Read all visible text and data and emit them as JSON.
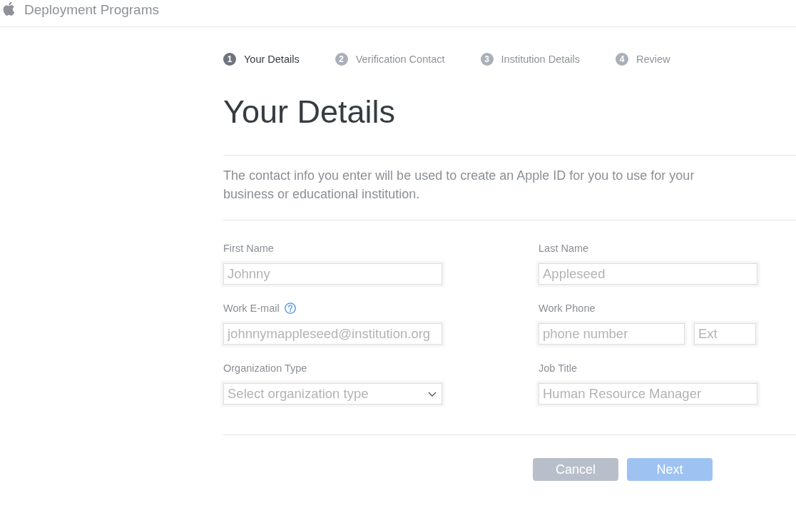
{
  "header": {
    "title": "Deployment Programs"
  },
  "steps": [
    {
      "number": "1",
      "label": "Your Details",
      "selected": true
    },
    {
      "number": "2",
      "label": "Verification Contact",
      "selected": false
    },
    {
      "number": "3",
      "label": "Institution Details",
      "selected": false
    },
    {
      "number": "4",
      "label": "Review",
      "selected": false
    }
  ],
  "page": {
    "title": "Your Details",
    "description": "The contact info you enter will be used to create an Apple ID for you to use for your business or educational institution."
  },
  "form": {
    "fields": [
      {
        "label": "First Name",
        "kind": "text",
        "help": false,
        "inputs": [
          {
            "placeholder": "Johnny"
          }
        ]
      },
      {
        "label": "Last Name",
        "kind": "text",
        "help": false,
        "inputs": [
          {
            "placeholder": "Appleseed"
          }
        ]
      },
      {
        "label": "Work E-mail",
        "kind": "text",
        "help": true,
        "inputs": [
          {
            "placeholder": "johnnymappleseed@institution.org"
          }
        ]
      },
      {
        "label": "Work Phone",
        "kind": "phone",
        "help": false,
        "inputs": [
          {
            "placeholder": "phone number"
          },
          {
            "placeholder": "Ext"
          }
        ]
      },
      {
        "label": "Organization Type",
        "kind": "select",
        "help": false,
        "inputs": [
          {
            "placeholder": "Select organization type"
          }
        ]
      },
      {
        "label": "Job Title",
        "kind": "text",
        "help": false,
        "inputs": [
          {
            "placeholder": "Human Resource Manager"
          }
        ]
      }
    ]
  },
  "buttons": [
    {
      "label": "Cancel",
      "kind": "secondary",
      "disabled": false
    },
    {
      "label": "Next",
      "kind": "primary",
      "disabled": true
    }
  ]
}
